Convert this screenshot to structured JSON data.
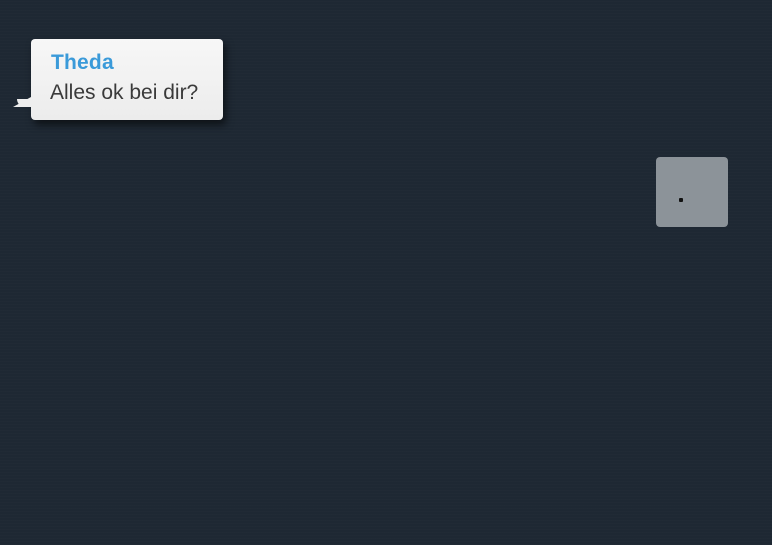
{
  "chat": {
    "message": {
      "sender": "Theda",
      "text": "Alles ok bei dir?"
    },
    "typing_indicator": {
      "dots": "."
    }
  },
  "colors": {
    "background": "#1e2833",
    "bubble": "#f0f0f0",
    "sender_name": "#3a9ad9",
    "message_text": "#3a3a3a",
    "typing_box": "#8c9399"
  }
}
